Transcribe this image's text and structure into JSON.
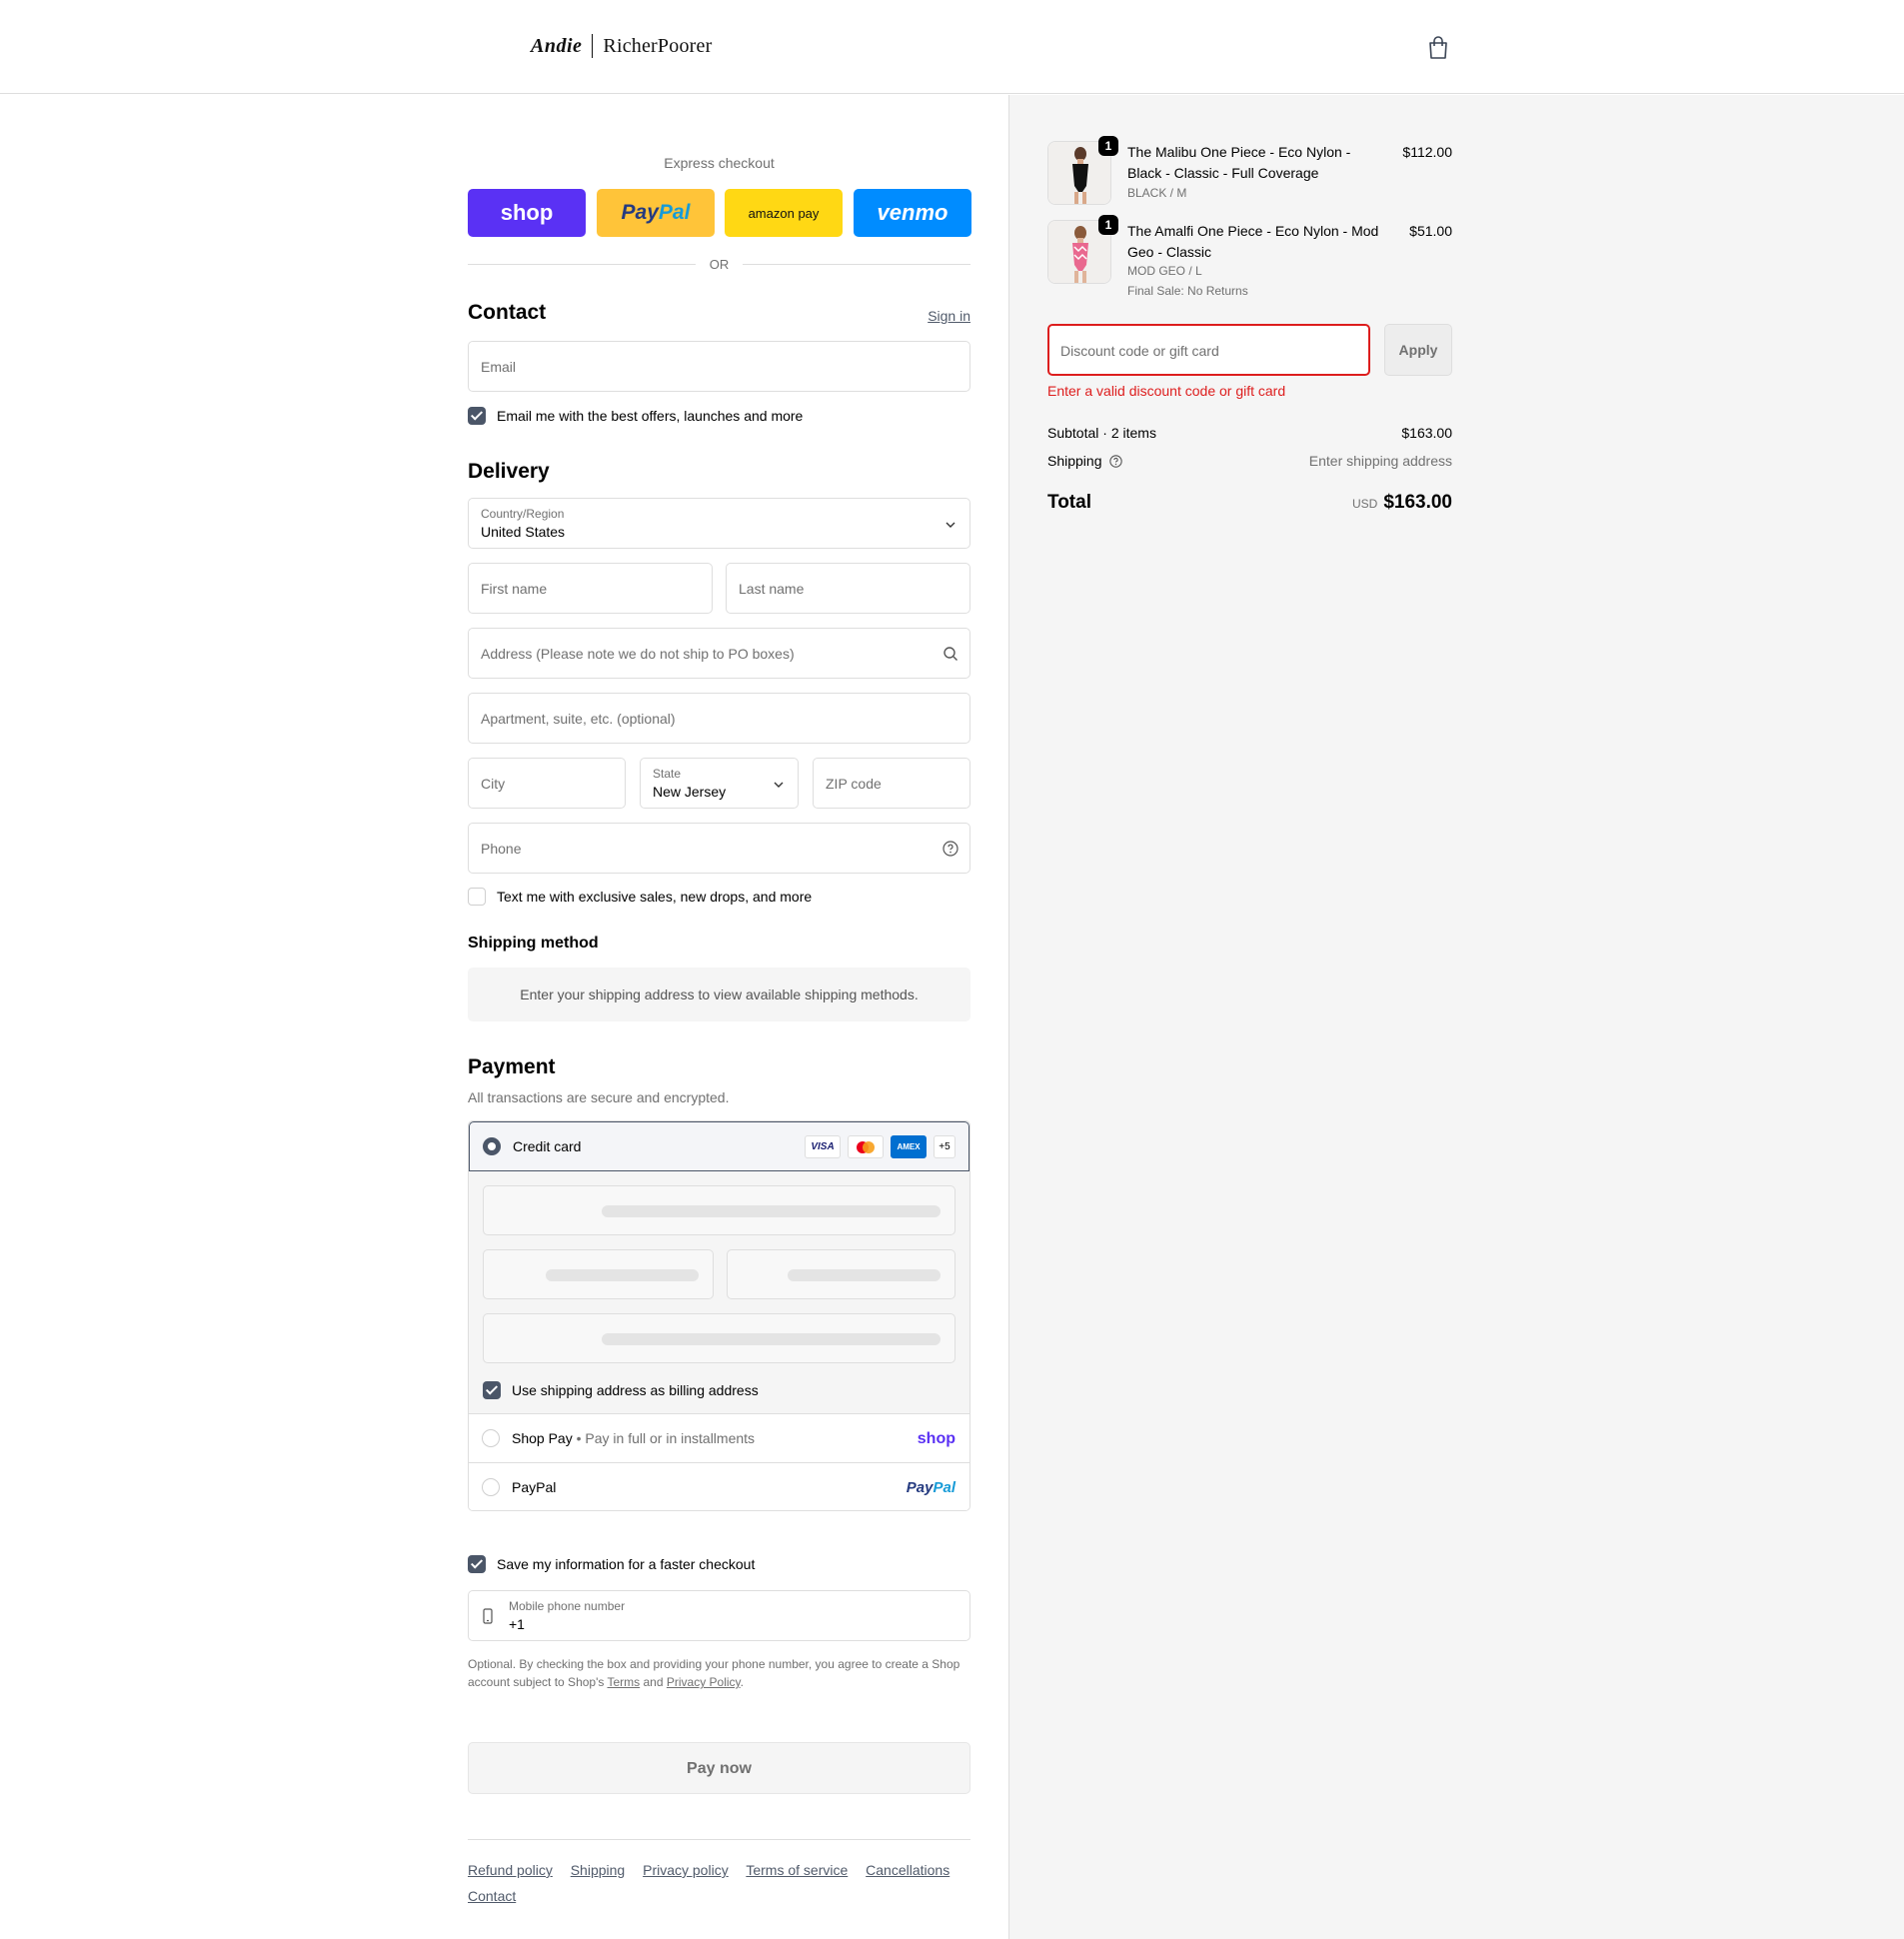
{
  "header": {
    "logo_left": "Andie",
    "logo_right": "RicherPoorer"
  },
  "express": {
    "title": "Express checkout",
    "shop": "shop",
    "paypal_a": "Pay",
    "paypal_b": "Pal",
    "amazon": "amazon pay",
    "venmo": "venmo",
    "or": "OR"
  },
  "contact": {
    "title": "Contact",
    "signin": "Sign in",
    "email_placeholder": "Email",
    "offers_label": "Email me with the best offers, launches and more"
  },
  "delivery": {
    "title": "Delivery",
    "country_label": "Country/Region",
    "country_value": "United States",
    "first_name": "First name",
    "last_name": "Last name",
    "address": "Address (Please note we do not ship to PO boxes)",
    "apartment": "Apartment, suite, etc. (optional)",
    "city": "City",
    "state_label": "State",
    "state_value": "New Jersey",
    "zip": "ZIP code",
    "phone": "Phone",
    "text_label": "Text me with exclusive sales, new drops, and more"
  },
  "shipping_method": {
    "title": "Shipping method",
    "message": "Enter your shipping address to view available shipping methods."
  },
  "payment": {
    "title": "Payment",
    "subtitle": "All transactions are secure and encrypted.",
    "credit_card": "Credit card",
    "cards": [
      "VISA",
      "AMEX",
      "+5"
    ],
    "billing_label": "Use shipping address as billing address",
    "shop_pay": "Shop Pay",
    "shop_pay_desc": "Pay in full or in installments",
    "shop_word": "shop",
    "paypal": "PayPal"
  },
  "save": {
    "label": "Save my information for a faster checkout",
    "phone_label": "Mobile phone number",
    "phone_value": "+1",
    "note_a": "Optional. By checking the box and providing your phone number, you agree to create a Shop account subject to Shop's ",
    "terms": "Terms",
    "and": " and ",
    "privacy": "Privacy Policy",
    "dot": "."
  },
  "pay_button": "Pay now",
  "footer": [
    "Refund policy",
    "Shipping",
    "Privacy policy",
    "Terms of service",
    "Cancellations",
    "Contact"
  ],
  "summary": {
    "items": [
      {
        "qty": "1",
        "name": "The Malibu One Piece - Eco Nylon - Black - Classic - Full Coverage",
        "variant": "BLACK / M",
        "note": "",
        "price": "$112.00"
      },
      {
        "qty": "1",
        "name": "The Amalfi One Piece - Eco Nylon - Mod Geo - Classic",
        "variant": "MOD GEO / L",
        "note": "Final Sale: No Returns",
        "price": "$51.00"
      }
    ],
    "discount_placeholder": "Discount code or gift card",
    "apply": "Apply",
    "error": "Enter a valid discount code or gift card",
    "subtotal_label": "Subtotal · 2 items",
    "subtotal_value": "$163.00",
    "shipping_label": "Shipping",
    "shipping_value": "Enter shipping address",
    "total_label": "Total",
    "currency": "USD",
    "total_value": "$163.00"
  },
  "colors": {
    "accent": "#4b5668",
    "error": "#dd1d1d",
    "shop": "#5a31f4",
    "paypal_bg": "#ffc439",
    "amazon_bg": "#ffd814",
    "venmo_bg": "#008cff"
  }
}
